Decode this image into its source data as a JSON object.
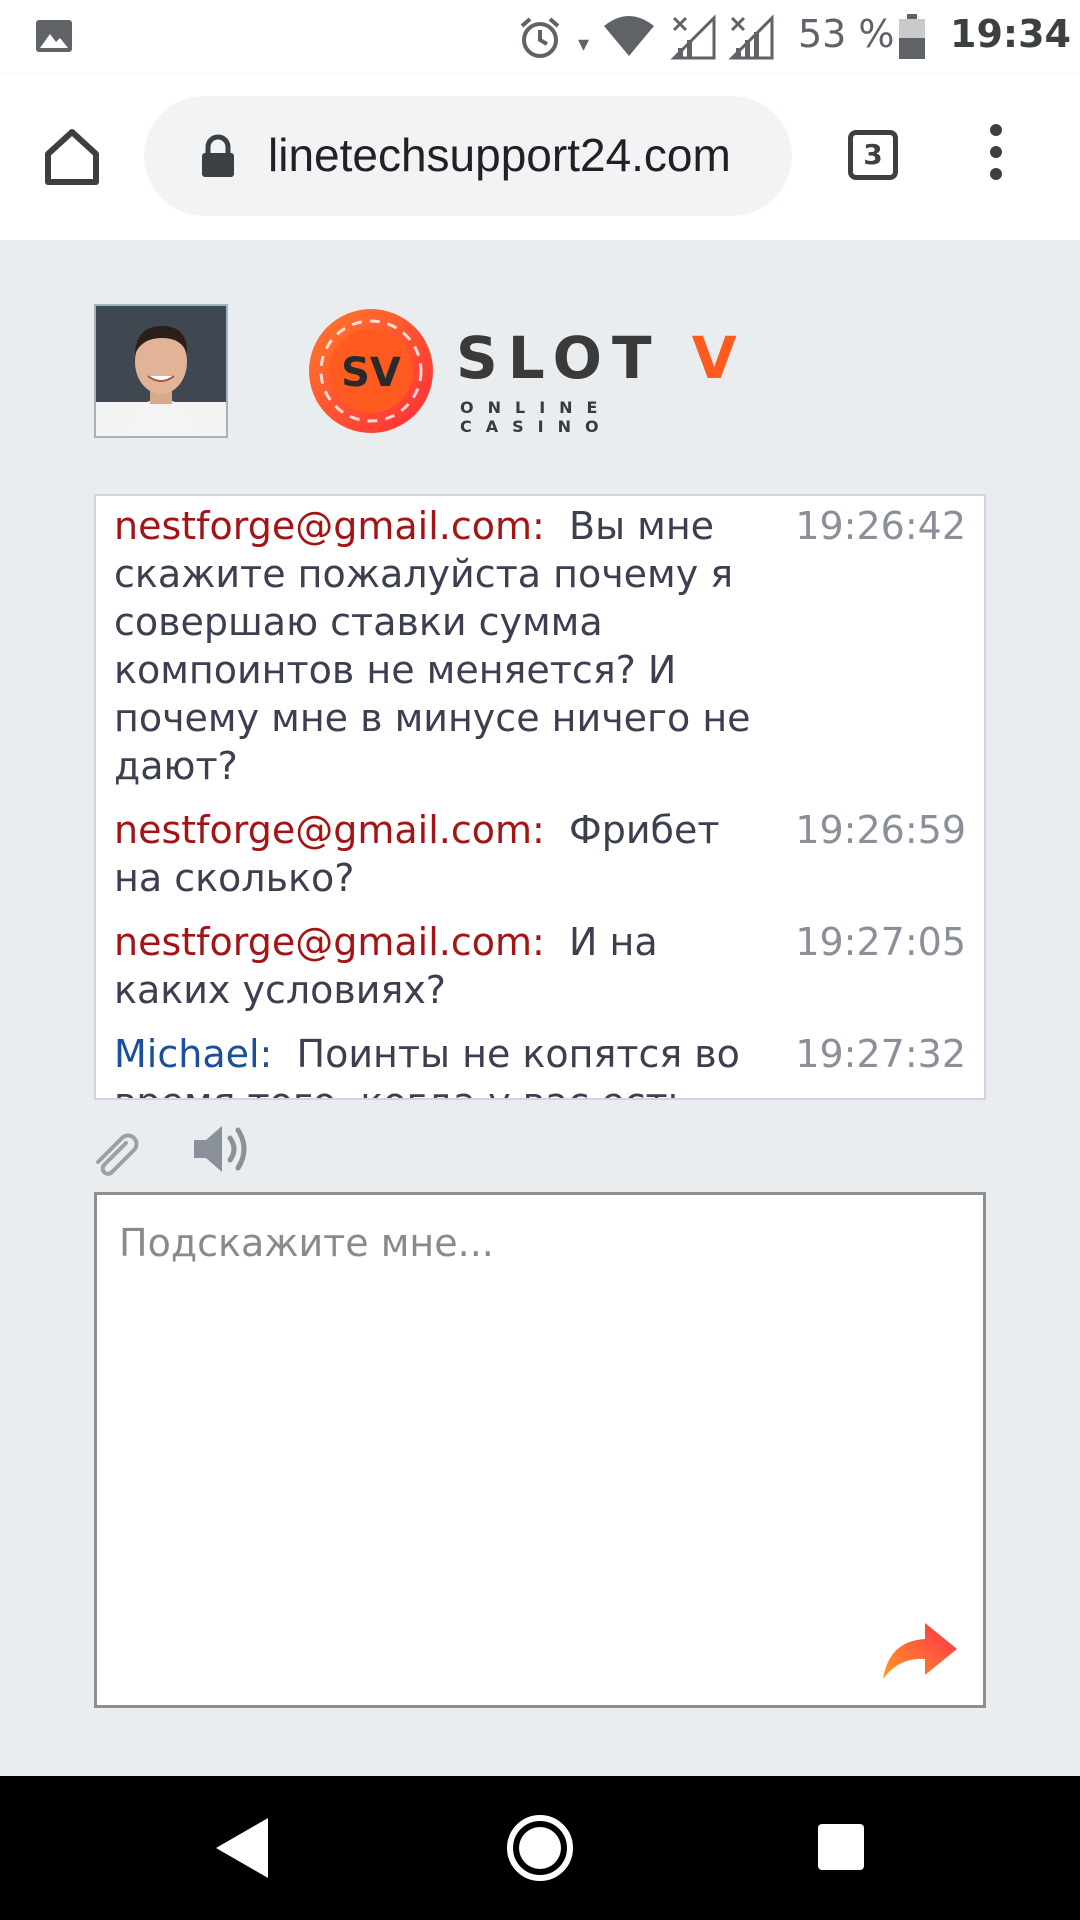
{
  "status_bar": {
    "battery_percent": "53 %",
    "time": "19:34",
    "icons": [
      "image-icon",
      "alarm-icon",
      "wifi-icon",
      "signal-icon",
      "signal-icon",
      "battery-icon"
    ]
  },
  "browser": {
    "url": "linetechsupport24.com",
    "tab_count": "3",
    "icons": [
      "home-icon",
      "lock-icon",
      "menu-icon"
    ]
  },
  "header": {
    "logo_title": "SLOT",
    "logo_title_v": "V",
    "logo_subtitle": "ONLINE CASINO",
    "logo_badge": "SV"
  },
  "chat": {
    "messages": [
      {
        "author": "nestforge@gmail.com:",
        "role": "user",
        "text": "Вы мне скажите пожалуйста почему я совершаю ставки сумма компоинтов не меняется? И почему мне в минусе ничего не дают?",
        "time": "19:26:42"
      },
      {
        "author": "nestforge@gmail.com:",
        "role": "user",
        "text": "Фрибет на сколько?",
        "time": "19:26:59"
      },
      {
        "author": "nestforge@gmail.com:",
        "role": "user",
        "text": "И на каких условиях?",
        "time": "19:27:05"
      },
      {
        "author": "Michael:",
        "role": "operator",
        "text": "Поинты не копятся во время того, когда у вас есть",
        "time": "19:27:32"
      }
    ]
  },
  "input": {
    "placeholder": "Подскажите мне..."
  },
  "colors": {
    "user_author": "#a31515",
    "operator_author": "#1a4f9c",
    "accent": "#ff5a1f"
  }
}
